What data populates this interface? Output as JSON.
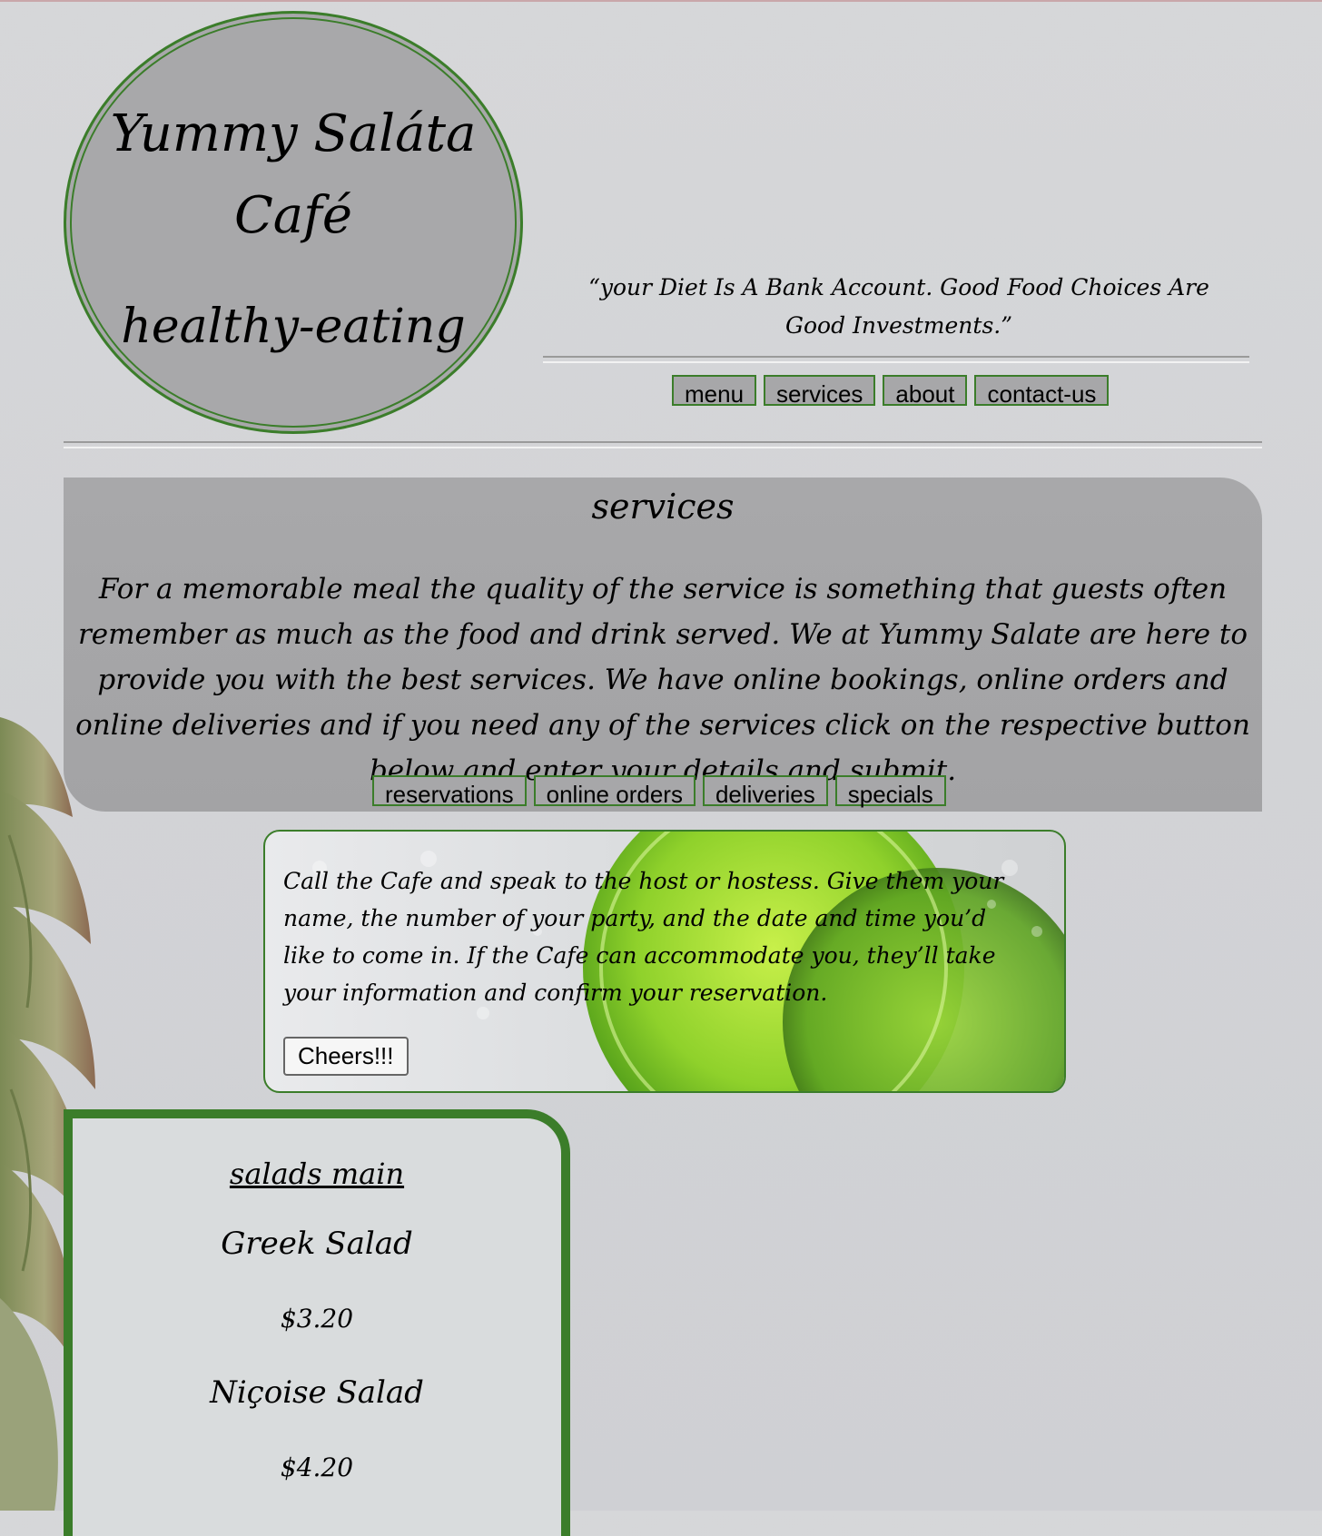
{
  "header": {
    "title": "Yummy Saláta Café",
    "tagline": "healthy-eating",
    "quote": "“your Diet Is A Bank Account. Good Food Choices Are Good Investments.”"
  },
  "nav": {
    "items": [
      {
        "label": "menu"
      },
      {
        "label": "services"
      },
      {
        "label": "about"
      },
      {
        "label": "contact-us"
      }
    ]
  },
  "services": {
    "title": "services",
    "text": "For a memorable meal the quality of the service is something that guests often remember as much as the food and drink served. We at Yummy Salate are here to provide you with the best services. We have online bookings, online orders and online deliveries and if you need any of the services click on the respective button below and enter your details and submit.",
    "buttons": [
      {
        "label": "reservations"
      },
      {
        "label": "online orders"
      },
      {
        "label": "deliveries"
      },
      {
        "label": "specials"
      }
    ]
  },
  "reservation_card": {
    "text": "Call the Cafe and speak to the host or hostess. Give them your name, the number of your party, and the date and time you’d like to come in. If the Cafe can accommodate you, they’ll take your information and confirm your reservation.",
    "button_label": "Cheers!!!"
  },
  "menu_card": {
    "heading": "salads main",
    "items": [
      {
        "name": "Greek Salad",
        "price": "$3.20"
      },
      {
        "name": "Niçoise Salad",
        "price": "$4.20"
      }
    ]
  },
  "colors": {
    "accent": "#3b7d2a",
    "panel": "#a8a8aa",
    "background": "#d4d5d8"
  }
}
